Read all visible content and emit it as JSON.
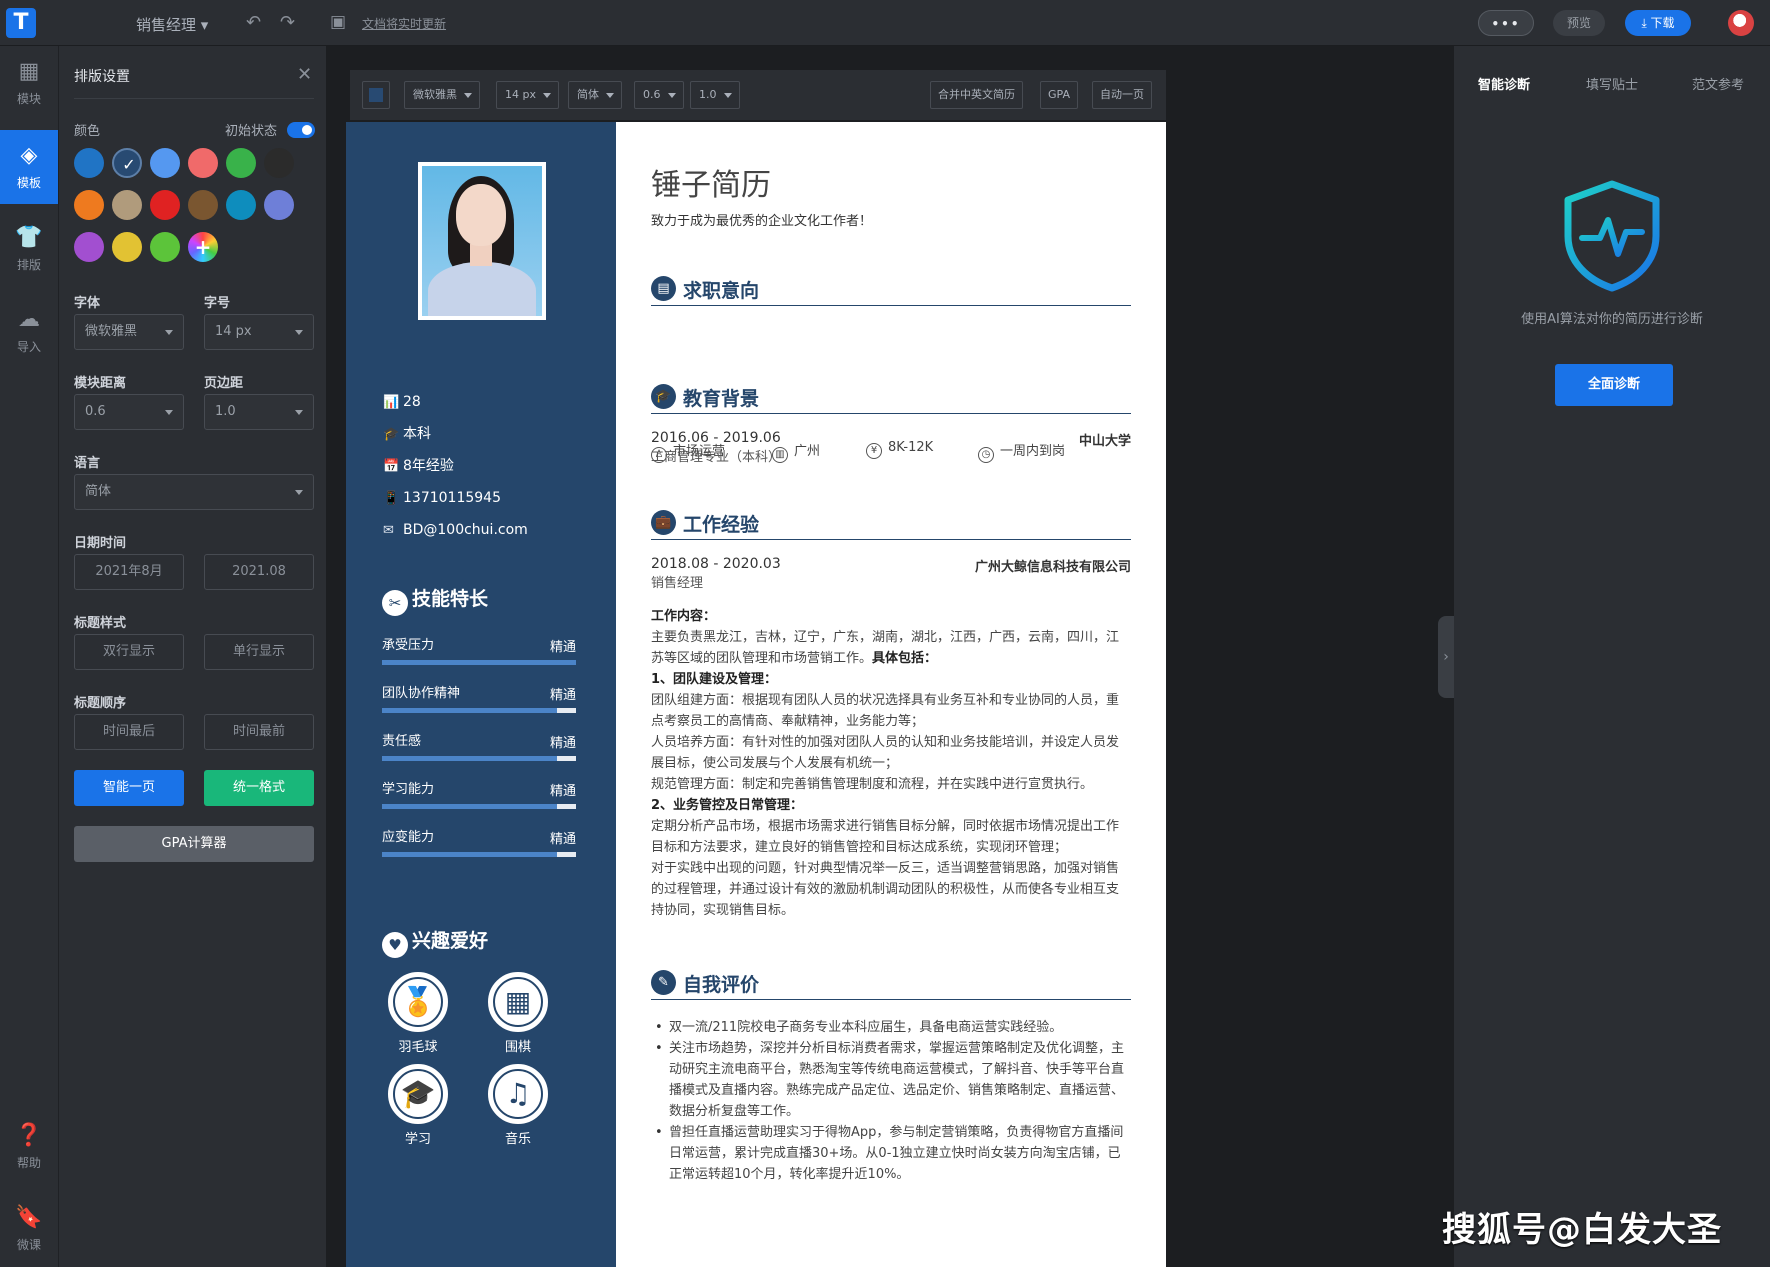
{
  "topbar": {
    "logo_letter": "T",
    "doc_title": "销售经理 ▾",
    "undo_icon": "undo-icon",
    "redo_icon": "redo-icon",
    "save_icon": "save-icon",
    "save_status": "文档将实时更新",
    "more_label": "•••",
    "preview_label": "预览",
    "download_label": "⤓ 下载"
  },
  "nav": {
    "items": [
      {
        "icon": "▦",
        "label": "模块"
      },
      {
        "icon": "◈",
        "label": "模板"
      },
      {
        "icon": "👕",
        "label": "排版"
      },
      {
        "icon": "☁",
        "label": "导入"
      },
      {
        "icon": "❓",
        "label": "帮助"
      },
      {
        "icon": "🔖",
        "label": "微课"
      }
    ]
  },
  "settings": {
    "title": "排版设置",
    "close": "✕",
    "color_label": "颜色",
    "initial_state_label": "初始状态",
    "colors": [
      "#2074c5",
      "#284a72",
      "#5598f0",
      "#f06a6a",
      "#39b24a",
      "#2b2b2b",
      "#ee7a1f",
      "#b09b7c",
      "#e02222",
      "#7a5630",
      "#0e8dbd",
      "#6e7fd8",
      "#a24fd0",
      "#e2c233",
      "#5cc43a"
    ],
    "selected_color": "#284a72",
    "font_label": "字体",
    "font_value": "微软雅黑",
    "size_label": "字号",
    "size_value": "14 px",
    "module_spacing_label": "模块距离",
    "module_spacing_value": "0.6",
    "margin_label": "页边距",
    "margin_value": "1.0",
    "language_label": "语言",
    "language_value": "简体",
    "date_label": "日期时间",
    "date_option_1": "2021年8月",
    "date_option_2": "2021.08",
    "title_style_label": "标题样式",
    "title_style_1": "双行显示",
    "title_style_2": "单行显示",
    "title_order_label": "标题顺序",
    "title_order_1": "时间最后",
    "title_order_2": "时间最前",
    "smart_page_btn": "智能一页",
    "unify_btn": "统一格式",
    "gpa_btn": "GPA计算器",
    "accent_blue": "#1a73e8",
    "accent_green": "#19b77a"
  },
  "format_bar": {
    "font": "微软雅黑",
    "size": "14 px",
    "lang": "简体",
    "spacing": "0.6",
    "margin": "1.0",
    "merge_btn": "合并中英文简历",
    "gpa_btn": "GPA",
    "auto_page_btn": "自动一页"
  },
  "resume": {
    "name": "锤子简历",
    "motto": "致力于成为最优秀的企业文化工作者！",
    "sidebar": {
      "info": [
        {
          "icon": "📊",
          "text": "28"
        },
        {
          "icon": "🎓",
          "text": "本科"
        },
        {
          "icon": "📅",
          "text": "8年经验"
        },
        {
          "icon": "📱",
          "text": "13710115945"
        },
        {
          "icon": "✉",
          "text": "BD@100chui.com"
        }
      ],
      "skills_title": "技能特长",
      "skills": [
        {
          "name": "承受压力",
          "level": "精通",
          "pct": 100
        },
        {
          "name": "团队协作精神",
          "level": "精通",
          "pct": 90
        },
        {
          "name": "责任感",
          "level": "精通",
          "pct": 90
        },
        {
          "name": "学习能力",
          "level": "精通",
          "pct": 90
        },
        {
          "name": "应变能力",
          "level": "精通",
          "pct": 90
        }
      ],
      "hobbies_title": "兴趣爱好",
      "hobbies": [
        {
          "icon": "🏅",
          "label": "羽毛球"
        },
        {
          "icon": "▦",
          "label": "围棋"
        },
        {
          "icon": "🎓",
          "label": "学习"
        },
        {
          "icon": "♫",
          "label": "音乐"
        }
      ]
    },
    "job_intent": {
      "title": "求职意向",
      "items": [
        {
          "icon": "♙",
          "text": "市场运营"
        },
        {
          "icon": "▥",
          "text": "广州"
        },
        {
          "icon": "¥",
          "text": "8K-12K"
        },
        {
          "icon": "◷",
          "text": "一周内到岗"
        }
      ]
    },
    "education": {
      "title": "教育背景",
      "period": "2016.06 - 2019.06",
      "school": "中山大学",
      "major": "工商管理专业（本科）"
    },
    "work": {
      "title": "工作经验",
      "period": "2018.08 - 2020.03",
      "company": "广州大鲸信息科技有限公司",
      "role": "销售经理",
      "content_label": "工作内容：",
      "line1": "主要负责黑龙江，吉林，辽宁，广东，湖南，湖北，江西，广西，云南，四川，江苏等区域的团队管理和市场营销工作。",
      "line1_bold": "具体包括：",
      "h1": "1、团队建设及管理：",
      "p1": "团队组建方面：根据现有团队人员的状况选择具有业务互补和专业协同的人员，重点考察员工的高情商、奉献精神，业务能力等；",
      "p2": "人员培养方面：有针对性的加强对团队人员的认知和业务技能培训，并设定人员发展目标，使公司发展与个人发展有机统一；",
      "p3": "规范管理方面：制定和完善销售管理制度和流程，并在实践中进行宣贯执行。",
      "h2": "2、业务管控及日常管理：",
      "p4": "定期分析产品市场，根据市场需求进行销售目标分解，同时依据市场情况提出工作目标和方法要求，建立良好的销售管控和目标达成系统，实现闭环管理；",
      "p5": "对于实践中出现的问题，针对典型情况举一反三，适当调整营销思路，加强对销售的过程管理，并通过设计有效的激励机制调动团队的积极性，从而使各专业相互支持协同，实现销售目标。"
    },
    "self_eval": {
      "title": "自我评价",
      "items": [
        "双一流/211院校电子商务专业本科应届生，具备电商运营实践经验。",
        "关注市场趋势，深挖并分析目标消费者需求，掌握运营策略制定及优化调整，主动研究主流电商平台，熟悉淘宝等传统电商运营模式，了解抖音、快手等平台直播模式及直播内容。熟练完成产品定位、选品定价、销售策略制定、直播运营、数据分析复盘等工作。",
        " 曾担任直播运营助理实习于得物App，参与制定营销策略，负责得物官方直播间日常运营，累计完成直播30+场。从0-1独立建立快时尚女装方向淘宝店铺，已正常运转超10个月，转化率提升近10%。"
      ]
    }
  },
  "right_panel": {
    "tabs": [
      "智能诊断",
      "填写贴士",
      "范文参考"
    ],
    "diag_text": "使用AI算法对你的简历进行诊断",
    "diag_btn": "全面诊断",
    "collapse_icon": "›"
  },
  "watermark": "搜狐号@白发大圣"
}
